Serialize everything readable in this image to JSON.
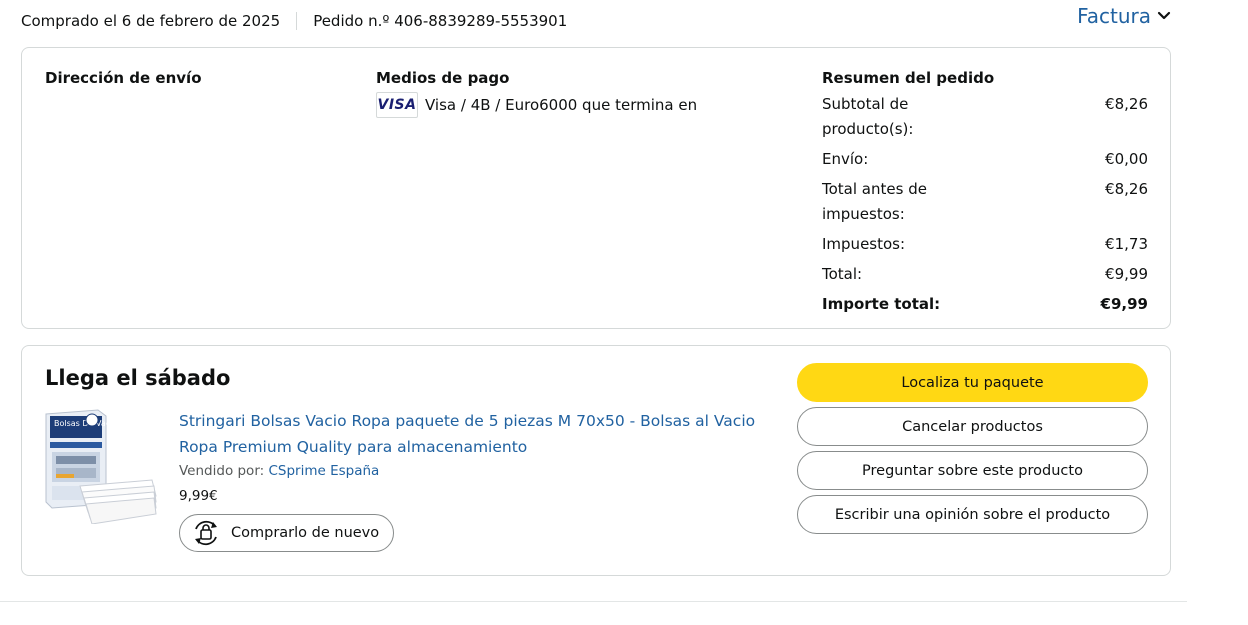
{
  "header": {
    "purchase_date": "Comprado el 6 de febrero de 2025",
    "order_number": "Pedido n.º 406-8839289-5553901",
    "invoice_label": "Factura"
  },
  "shipping": {
    "title": "Dirección de envío"
  },
  "payment": {
    "title": "Medios de pago",
    "card_brand": "VISA",
    "card_text": "Visa / 4B / Euro6000  que termina en"
  },
  "summary": {
    "title": "Resumen del pedido",
    "rows": [
      {
        "label": "Subtotal de producto(s):",
        "value": "€8,26"
      },
      {
        "label": "Envío:",
        "value": "€0,00"
      },
      {
        "label": "Total antes de impuestos:",
        "value": "€8,26"
      },
      {
        "label": "Impuestos:",
        "value": "€1,73"
      },
      {
        "label": "Total:",
        "value": "€9,99"
      },
      {
        "label": "Importe total:",
        "value": "€9,99"
      }
    ]
  },
  "shipment": {
    "arrival": "Llega el sábado",
    "product_title": "Stringari Bolsas Vacio Ropa paquete de 5 piezas M 70x50 - Bolsas al Vacio Ropa Premium Quality para almacenamiento",
    "sold_by_label": "Vendido por:",
    "seller": "CSprime España",
    "price": "9,99€",
    "buy_again": "Comprarlo de nuevo",
    "product_image_text": "Bolsas De Vacio"
  },
  "actions": {
    "track": "Localiza tu paquete",
    "cancel": "Cancelar productos",
    "ask": "Preguntar sobre este producto",
    "review": "Escribir una opinión sobre el producto"
  },
  "colors": {
    "link": "#2162a1",
    "primary_button": "#ffd814",
    "border": "#d5d9d9"
  }
}
